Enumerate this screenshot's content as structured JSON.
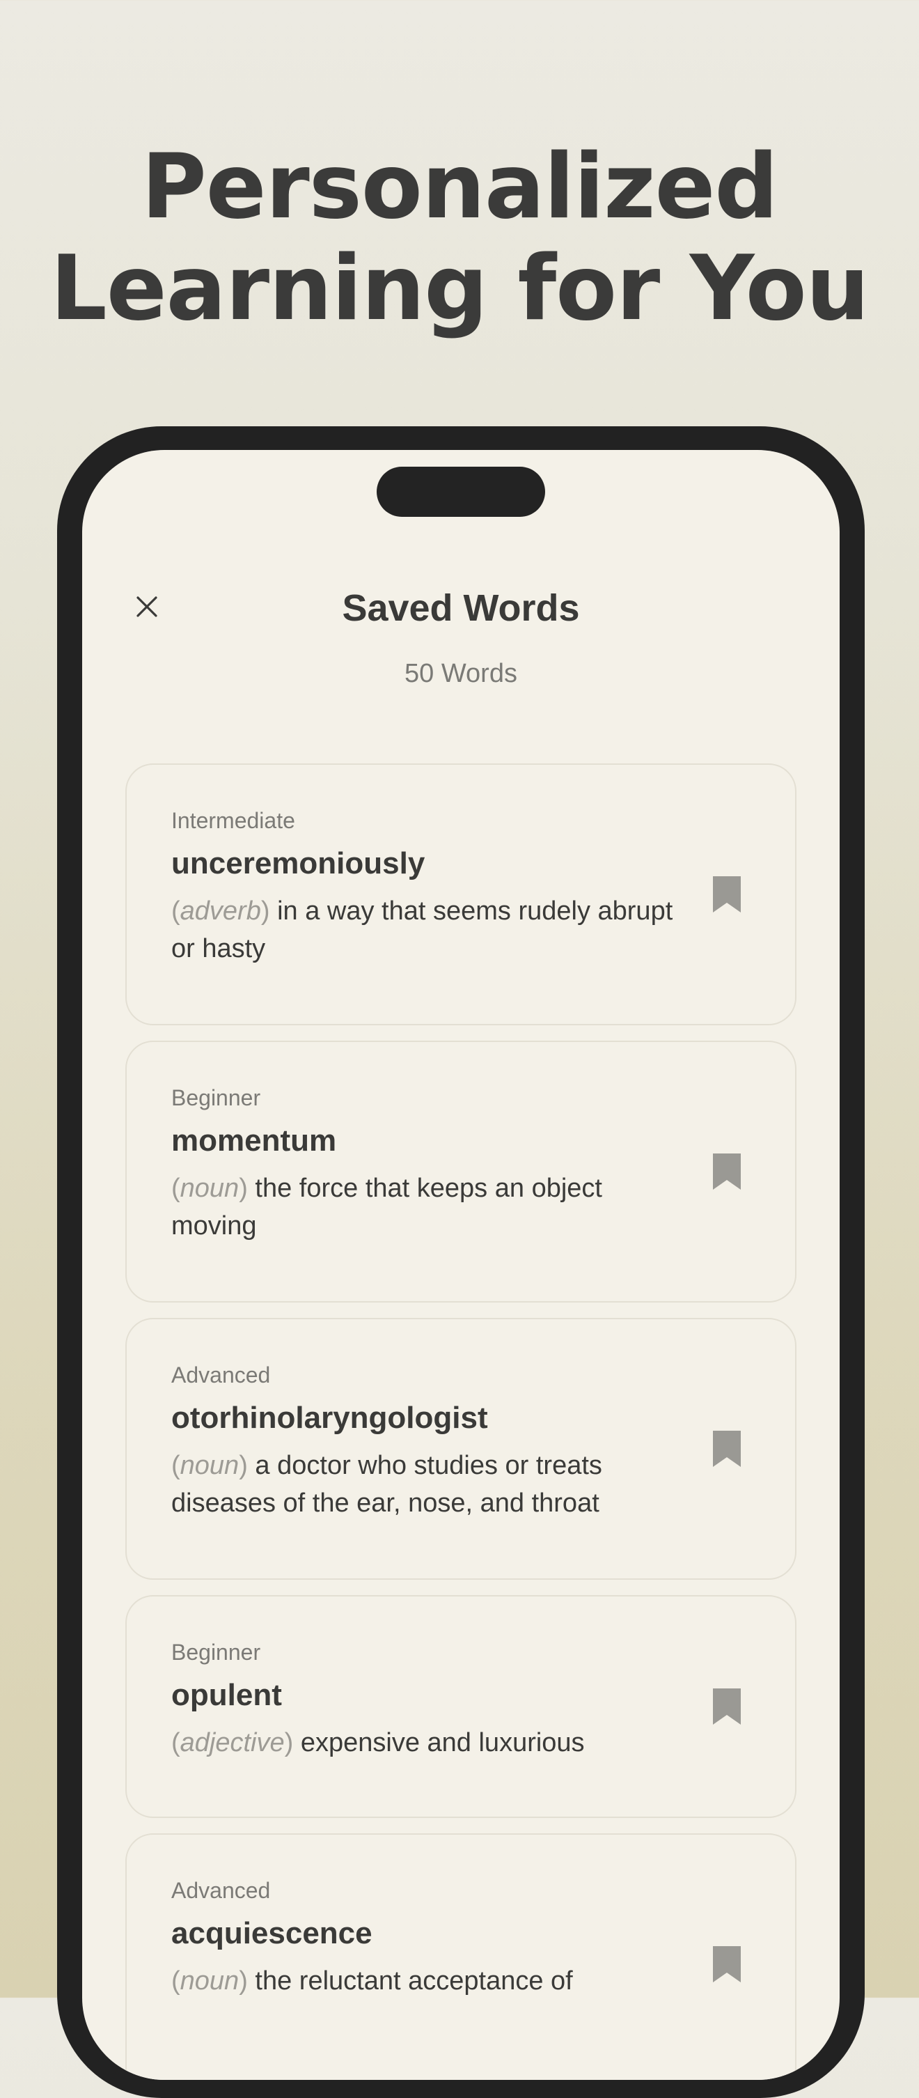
{
  "headline": {
    "line1": "Personalized",
    "line2": "Learning for You"
  },
  "screen": {
    "title": "Saved Words",
    "count": "50 Words",
    "close_icon": "close-icon"
  },
  "words": [
    {
      "level": "Intermediate",
      "word": "unceremoniously",
      "pos": "adverb",
      "definition": "in a way that seems rudely abrupt or hasty",
      "bookmark_icon": "bookmark-icon"
    },
    {
      "level": "Beginner",
      "word": "momentum",
      "pos": "noun",
      "definition": "the force that keeps an object moving",
      "bookmark_icon": "bookmark-icon"
    },
    {
      "level": "Advanced",
      "word": "otorhinolaryngologist",
      "pos": "noun",
      "definition": "a doctor who studies or treats diseases of the ear, nose, and throat",
      "bookmark_icon": "bookmark-icon"
    },
    {
      "level": "Beginner",
      "word": "opulent",
      "pos": "adjective",
      "definition": "expensive and luxurious",
      "bookmark_icon": "bookmark-icon"
    },
    {
      "level": "Advanced",
      "word": "acquiescence",
      "pos": "noun",
      "definition": "the reluctant acceptance of",
      "bookmark_icon": "bookmark-icon"
    }
  ],
  "colors": {
    "accent_text": "#3a3a38",
    "muted_text": "#7b7a76",
    "bookmark": "#9a9994",
    "phone_frame": "#222222",
    "screen_bg": "#f4f1e8"
  },
  "paren_open": "(",
  "paren_close": ")"
}
